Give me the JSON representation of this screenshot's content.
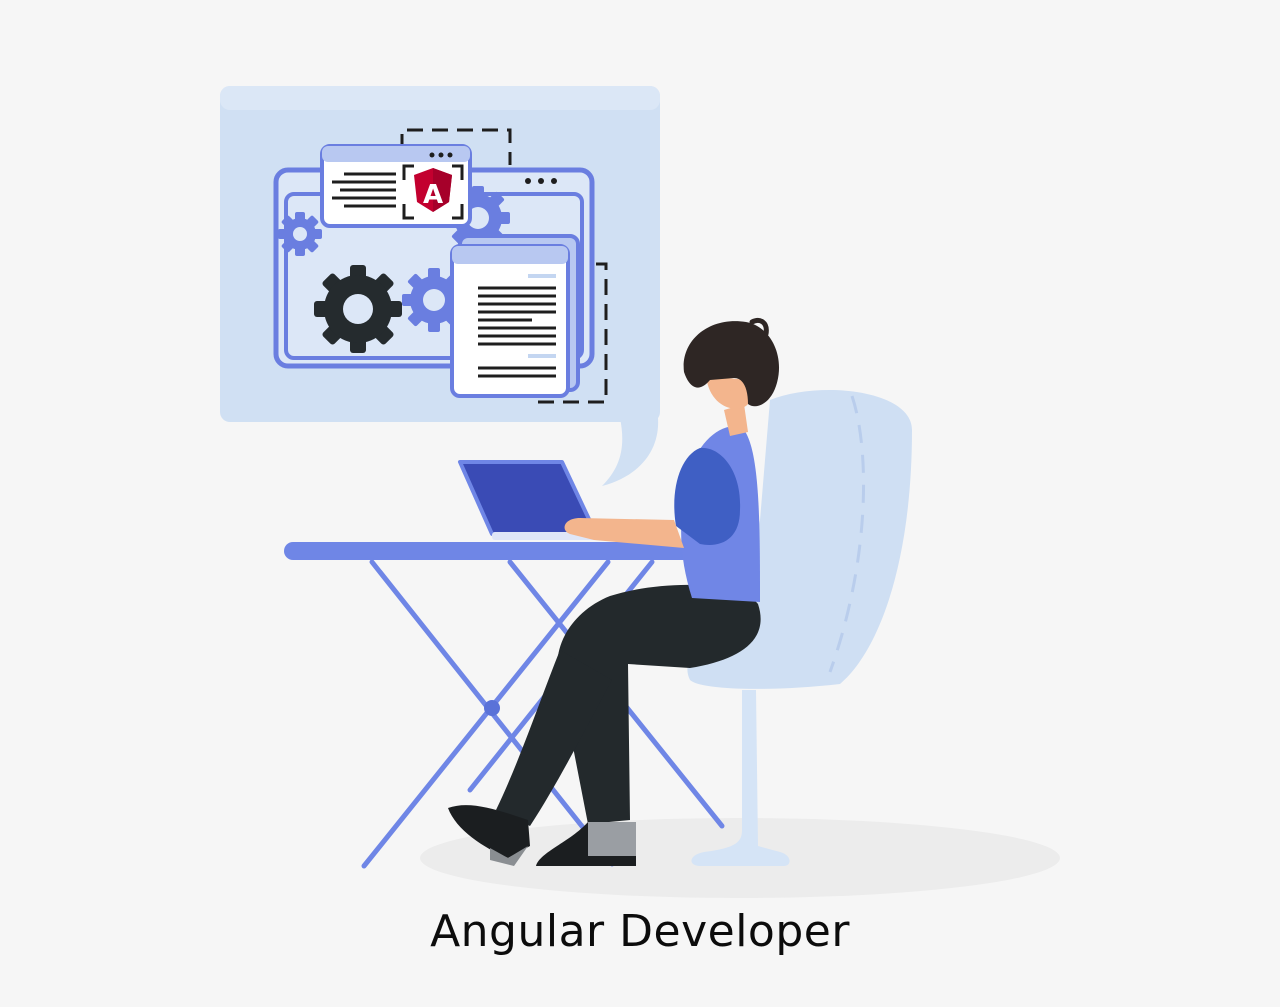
{
  "caption": "Angular Developer",
  "badge_letter": "A",
  "colors": {
    "background": "#f6f6f6",
    "bubble": "#d0e0f3",
    "window_stroke": "#6a7ee0",
    "gear_dark": "#252b2e",
    "desk": "#6f86e6",
    "chair": "#cfdff3",
    "laptop": "#3a4bb5",
    "angular_red": "#c3002f",
    "shirt": "#3f5fc4",
    "pants": "#23292c",
    "hair": "#2e2624",
    "skin": "#f3b58d"
  },
  "icons": [
    "speech-bubble",
    "browser-window-icon",
    "angular-logo-icon",
    "gear-icon",
    "document-icon",
    "laptop-icon",
    "desk",
    "chair",
    "developer-person"
  ]
}
